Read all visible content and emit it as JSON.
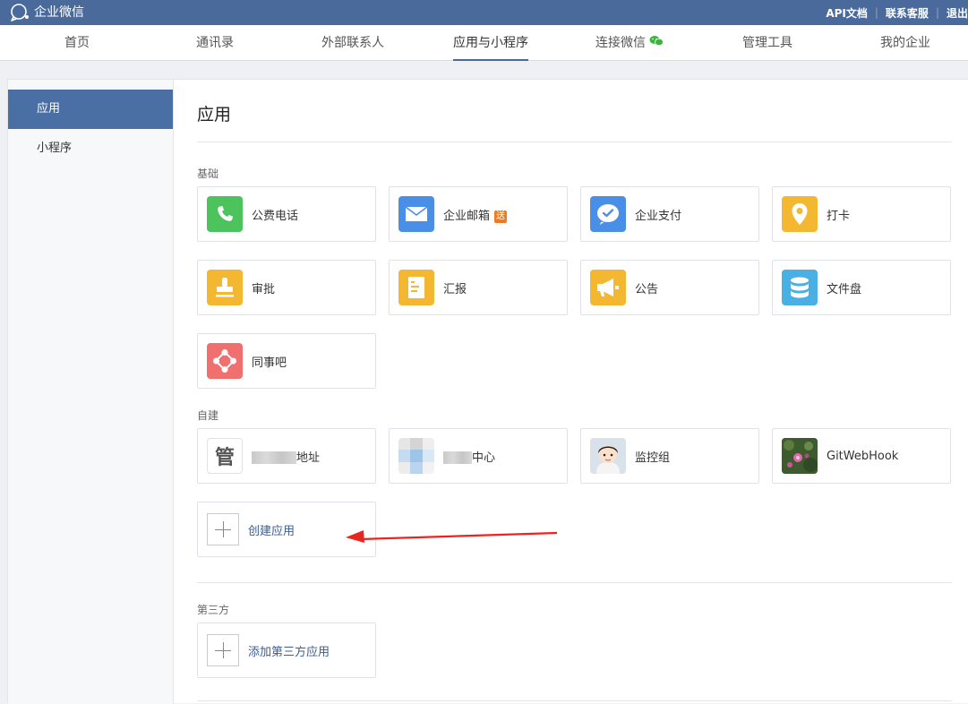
{
  "brand": {
    "name": "企业微信"
  },
  "top_links": [
    "API文档",
    "联系客服",
    "退出"
  ],
  "nav": {
    "items": [
      {
        "label": "首页"
      },
      {
        "label": "通讯录"
      },
      {
        "label": "外部联系人"
      },
      {
        "label": "应用与小程序",
        "active": true
      },
      {
        "label": "连接微信",
        "icon": "wechat-icon"
      },
      {
        "label": "管理工具"
      },
      {
        "label": "我的企业"
      }
    ]
  },
  "sidebar": {
    "items": [
      {
        "label": "应用",
        "active": true
      },
      {
        "label": "小程序"
      }
    ]
  },
  "main": {
    "title": "应用",
    "sections": {
      "basic": {
        "label": "基础",
        "apps": [
          {
            "label": "公费电话",
            "icon": "phone-icon",
            "color": "#4cc35d"
          },
          {
            "label": "企业邮箱",
            "icon": "mail-icon",
            "color": "#4a8fe7",
            "badge": "送"
          },
          {
            "label": "企业支付",
            "icon": "payment-icon",
            "color": "#4a8fe7"
          },
          {
            "label": "打卡",
            "icon": "location-pin-icon",
            "color": "#f3b731"
          },
          {
            "label": "审批",
            "icon": "stamp-icon",
            "color": "#f3b731"
          },
          {
            "label": "汇报",
            "icon": "report-icon",
            "color": "#f3b731"
          },
          {
            "label": "公告",
            "icon": "megaphone-icon",
            "color": "#f3b731"
          },
          {
            "label": "文件盘",
            "icon": "database-icon",
            "color": "#4ab0e3"
          },
          {
            "label": "同事吧",
            "icon": "network-icon",
            "color": "#f06f6f"
          }
        ]
      },
      "custom": {
        "label": "自建",
        "apps": [
          {
            "label": "地址",
            "icon_text": "管",
            "icon": "guan-text-icon"
          },
          {
            "label": "中心",
            "icon": "pixelated-icon"
          },
          {
            "label": "监控组",
            "icon": "cartoon-avatar-icon"
          },
          {
            "label": "GitWebHook",
            "icon": "flower-photo-icon"
          }
        ],
        "create_label": "创建应用"
      },
      "third_party": {
        "label": "第三方",
        "add_label": "添加第三方应用"
      }
    }
  }
}
